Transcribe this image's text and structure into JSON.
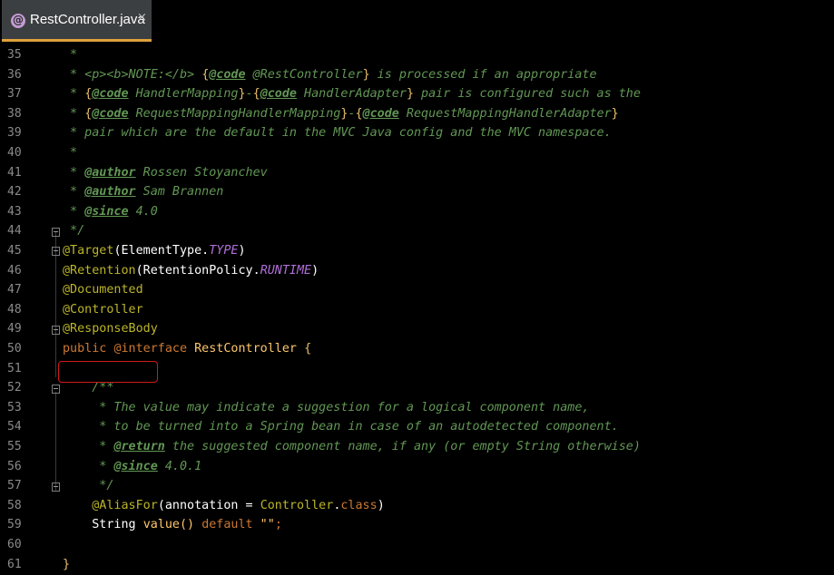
{
  "tab": {
    "title": "RestController.java",
    "close": "×"
  },
  "line_numbers": [
    "35",
    "36",
    "37",
    "38",
    "39",
    "40",
    "41",
    "42",
    "43",
    "44",
    "45",
    "46",
    "47",
    "48",
    "49",
    "50",
    "51",
    "52",
    "53",
    "54",
    "55",
    "56",
    "57",
    "58",
    "59",
    "60",
    "61"
  ],
  "code": {
    "l35": " * ",
    "l36a": " * <p><b>NOTE:</b> ",
    "l36b": "{",
    "l36c": "@code",
    "l36d": " @RestController",
    "l36e": "}",
    "l36f": " is processed if an appropriate",
    "l37a": " * ",
    "l37b": "{",
    "l37c": "@code",
    "l37d": " HandlerMapping",
    "l37e": "}",
    "l37f": "-",
    "l37g": "{",
    "l37h": "@code",
    "l37i": " HandlerAdapter",
    "l37j": "}",
    "l37k": " pair is configured such as the",
    "l38a": " * ",
    "l38b": "{",
    "l38c": "@code",
    "l38d": " RequestMappingHandlerMapping",
    "l38e": "}",
    "l38f": "-",
    "l38g": "{",
    "l38h": "@code",
    "l38i": " RequestMappingHandlerAdapter",
    "l38j": "}",
    "l39": " * pair which are the default in the MVC Java config and the MVC namespace.",
    "l40": " * ",
    "l41a": " * ",
    "l41b": "@author",
    "l41c": " Rossen Stoyanchev",
    "l42a": " * ",
    "l42b": "@author",
    "l42c": " Sam Brannen",
    "l43a": " * ",
    "l43b": "@since",
    "l43c": " 4.0",
    "l44": " */",
    "l45a": "@Target",
    "l45b": "(ElementType.",
    "l45c": "TYPE",
    "l45d": ")",
    "l46a": "@Retention",
    "l46b": "(RetentionPolicy.",
    "l46c": "RUNTIME",
    "l46d": ")",
    "l47": "@Documented",
    "l48": "@Controller",
    "l49": "@ResponseBody",
    "l50a": "public ",
    "l50b": "@interface",
    "l50c": " RestController ",
    "l50d": "{",
    "l52": "    /**",
    "l53": "     * The value may indicate a suggestion for a logical component name,",
    "l54": "     * to be turned into a Spring bean in case of an autodetected component.",
    "l55a": "     * ",
    "l55b": "@return",
    "l55c": " the suggested component name, if any (or empty String otherwise)",
    "l56a": "     * ",
    "l56b": "@since",
    "l56c": " 4.0.1",
    "l57": "     */",
    "l58a": "    @AliasFor",
    "l58b": "(annotation = ",
    "l58c": "Controller",
    "l58d": ".",
    "l58e": "class",
    "l58f": ")",
    "l59a": "    String ",
    "l59b": "value",
    "l59c": "() ",
    "l59d": "default",
    "l59e": " \"\"",
    "l59f": ";",
    "l61": "}"
  },
  "colors": {
    "comment": "#629755",
    "annotation": "#bbb529",
    "keyword": "#cc7832",
    "constant": "#b06fd8",
    "highlight_box": "#d01a1a",
    "tab_underline": "#e0a23c"
  }
}
